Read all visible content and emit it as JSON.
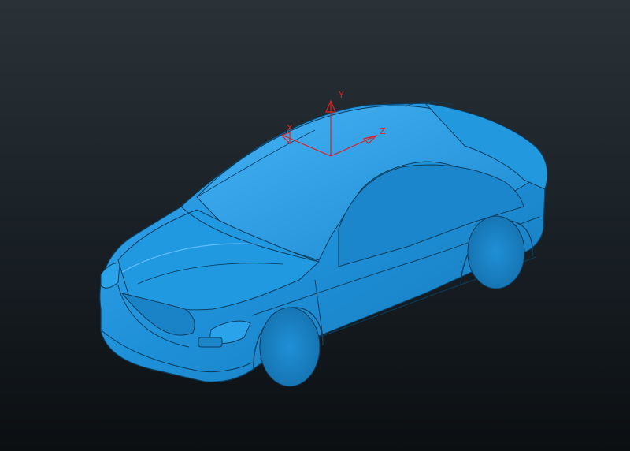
{
  "viewport": {
    "background_top": "#2a3238",
    "background_bottom": "#0b0f12"
  },
  "model": {
    "icon": "car-body-3d-model",
    "surface_color": "#1e90d8",
    "edge_color": "#0b3e5f",
    "highlight_color": "#6fc6ff"
  },
  "triad": {
    "color": "#e02020",
    "axes": {
      "x_label": "X",
      "y_label": "Y",
      "z_label": "Z"
    }
  }
}
